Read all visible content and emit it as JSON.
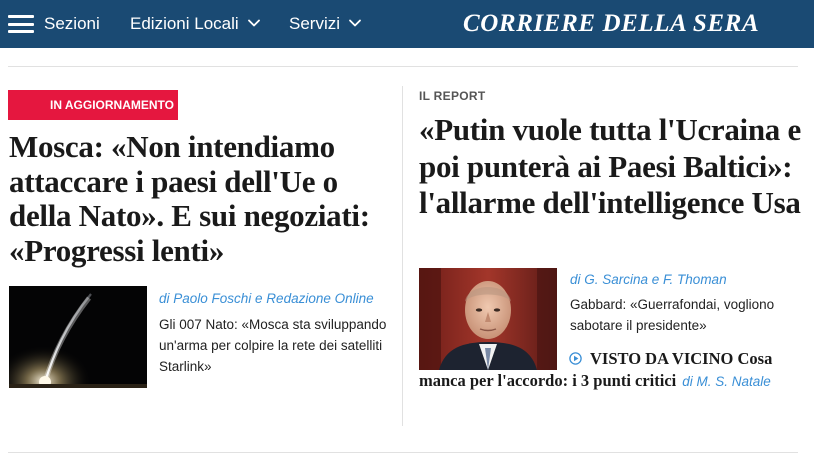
{
  "header": {
    "nav": {
      "sezioni": "Sezioni",
      "edizioni_locali": "Edizioni Locali",
      "servizi": "Servizi"
    },
    "logo_text": "CORRIERE DELLA SERA",
    "background_color": "#1a4a73"
  },
  "left_story": {
    "badge": "IN AGGIORNAMENTO",
    "badge_color": "#e5173f",
    "headline": "Mosca: «Non intendiamo attaccare i paesi dell'Ue o della Nato». E sui negoziati: «Progressi lenti»",
    "byline": "di Paolo Foschi e Redazione Online",
    "summary": "Gli 007 Nato: «Mosca sta sviluppando un'arma per colpire la rete dei satelliti Starlink»",
    "image_icon": "rocket-launch-photo"
  },
  "right_story": {
    "kicker": "IL REPORT",
    "headline": "«Putin vuole tutta l'Ucraina e poi punterà ai Paesi Baltici»: l'allarme dell'intelligence Usa",
    "byline": "di G. Sarcina e F. Thoman",
    "summary": "Gabbard: «Guerrafondai, vogliono sabotare il presidente»",
    "image_icon": "portrait-photo",
    "related": {
      "icon": "play-icon",
      "text": "VISTO DA VICINO Cosa manca per l'accordo: i 3 punti critici",
      "byline": "di M. S. Natale"
    }
  },
  "colors": {
    "byline": "#3a8fd6",
    "text": "#1a1a1a",
    "rule": "#e1e1e1"
  }
}
